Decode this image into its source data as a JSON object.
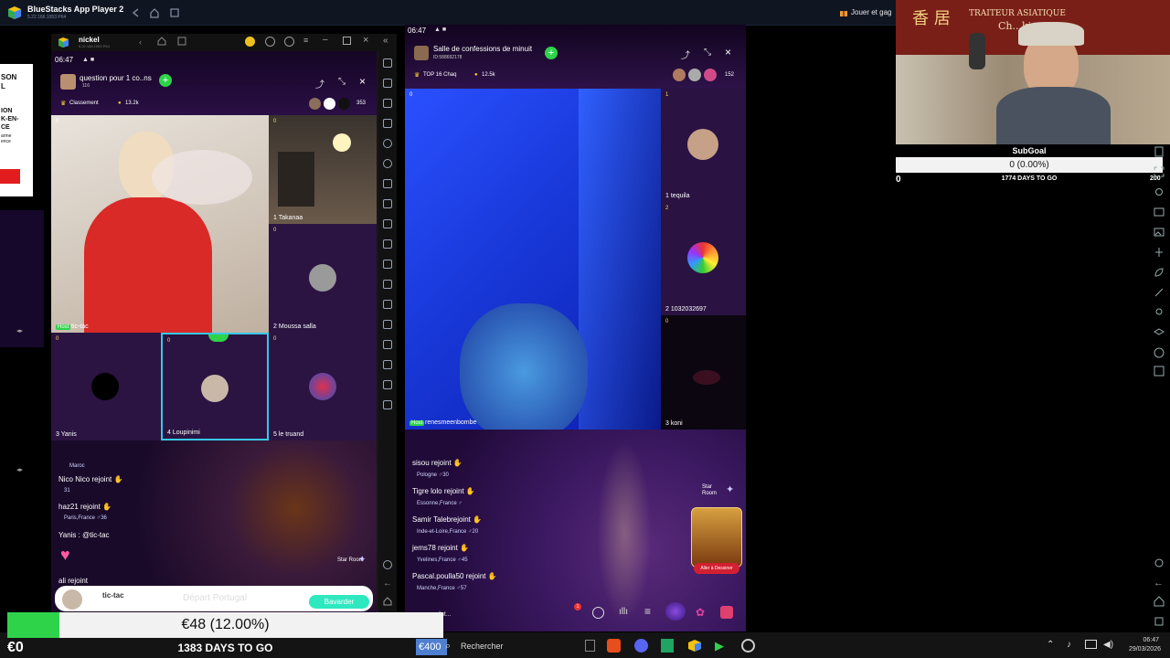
{
  "outer_window": {
    "title": "BlueStacks App Player 2",
    "subtitle": "5.22.166.1053 P64"
  },
  "promo_text": "Jouer et gag",
  "left_promo": {
    "line1": "SON",
    "line2": "L",
    "line3": "ION",
    "line4": "K-EN-",
    "line5": "CE",
    "line6": "arme",
    "line7": "ence"
  },
  "inner_window": {
    "title": "nickel",
    "subtitle": "5.22.166.1053 P64"
  },
  "room1": {
    "status_time": "06:47",
    "room_title": "question pour 1 co..ns",
    "room_id": "116",
    "ranking_label": "Classement",
    "coins": "13.2k",
    "viewers": "353",
    "host_name": "tic-tac",
    "host_tag": "Host",
    "seats": [
      {
        "num": "1",
        "name": "Takanaa",
        "count": "0"
      },
      {
        "num": "2",
        "name": "Moussa salla",
        "count": "0"
      },
      {
        "num": "3",
        "name": "Yanis",
        "count": "0"
      },
      {
        "num": "4",
        "name": "Loupinimi",
        "count": "0"
      },
      {
        "num": "5",
        "name": "le truand",
        "count": "0"
      }
    ],
    "chat": [
      {
        "text": "Maroc",
        "loc": ""
      },
      {
        "text": "Nico Nico rejoint",
        "loc": "",
        "num": "31"
      },
      {
        "text": "haz21 rejoint",
        "loc": "Paris,France",
        "num": "36"
      },
      {
        "text": "Yanis : @tic-tac",
        "loc": ""
      },
      {
        "text": "ali rejoint",
        "loc": ""
      }
    ],
    "star_room": "Star Room",
    "bottom_user": "tic-tac",
    "depart_text": "Départ Portugal",
    "bavarder_label": "Bavarder"
  },
  "room2": {
    "status_time": "06:47",
    "room_title": "Salle de confessions de minuit",
    "room_id": "ID:588692178",
    "top_label": "TOP 16 Chaq",
    "coins": "12.5k",
    "viewers": "152",
    "host_tag": "Host",
    "host_name": "renesmeenbombe",
    "seats": [
      {
        "num": "1",
        "name": "tequila",
        "count": "1"
      },
      {
        "num": "2",
        "name": "1032032697",
        "count": "2"
      },
      {
        "num": "3",
        "name": "koni",
        "count": "0"
      }
    ],
    "chat": [
      {
        "name": "sisou rejoint",
        "loc": "Pologne",
        "num": "30"
      },
      {
        "name": "Tigre lolo rejoint",
        "loc": "Essonne,France",
        "num": ""
      },
      {
        "name": "Samir Talebrejoint",
        "loc": "Inde-et-Loire,France",
        "num": "20"
      },
      {
        "name": "jems78 rejoint",
        "loc": "Yvelines,France",
        "num": "45"
      },
      {
        "name": "Pascal.poulla50 rejoint",
        "loc": "Manche,France",
        "num": "57"
      }
    ],
    "star_room": "Star Room",
    "game_badge": "Aller à Dessiner",
    "input_placeholder": "salut..."
  },
  "goal": {
    "name": "SubGoal",
    "progress_text": "0 (0.00%)",
    "progress": 0.0,
    "left": "0",
    "right": "200",
    "days": "1774 DAYS TO GO"
  },
  "webcam_sign": {
    "line1": "香  居",
    "line2": "TRAITEUR ASIATIQUE",
    "line3": "Ch...king"
  },
  "money_goal": {
    "current": "€0",
    "progress_text": "€48 (12.00%)",
    "progress": 0.12,
    "days": "1383 DAYS TO GO",
    "target": "€400"
  },
  "taskbar": {
    "search": "Rechercher",
    "time": "06:47",
    "date": "29/03/2026"
  },
  "colors": {
    "accent_green": "#2ed34a",
    "brand_blue": "#1e88e5",
    "room_purple": "#3a1a5e"
  }
}
